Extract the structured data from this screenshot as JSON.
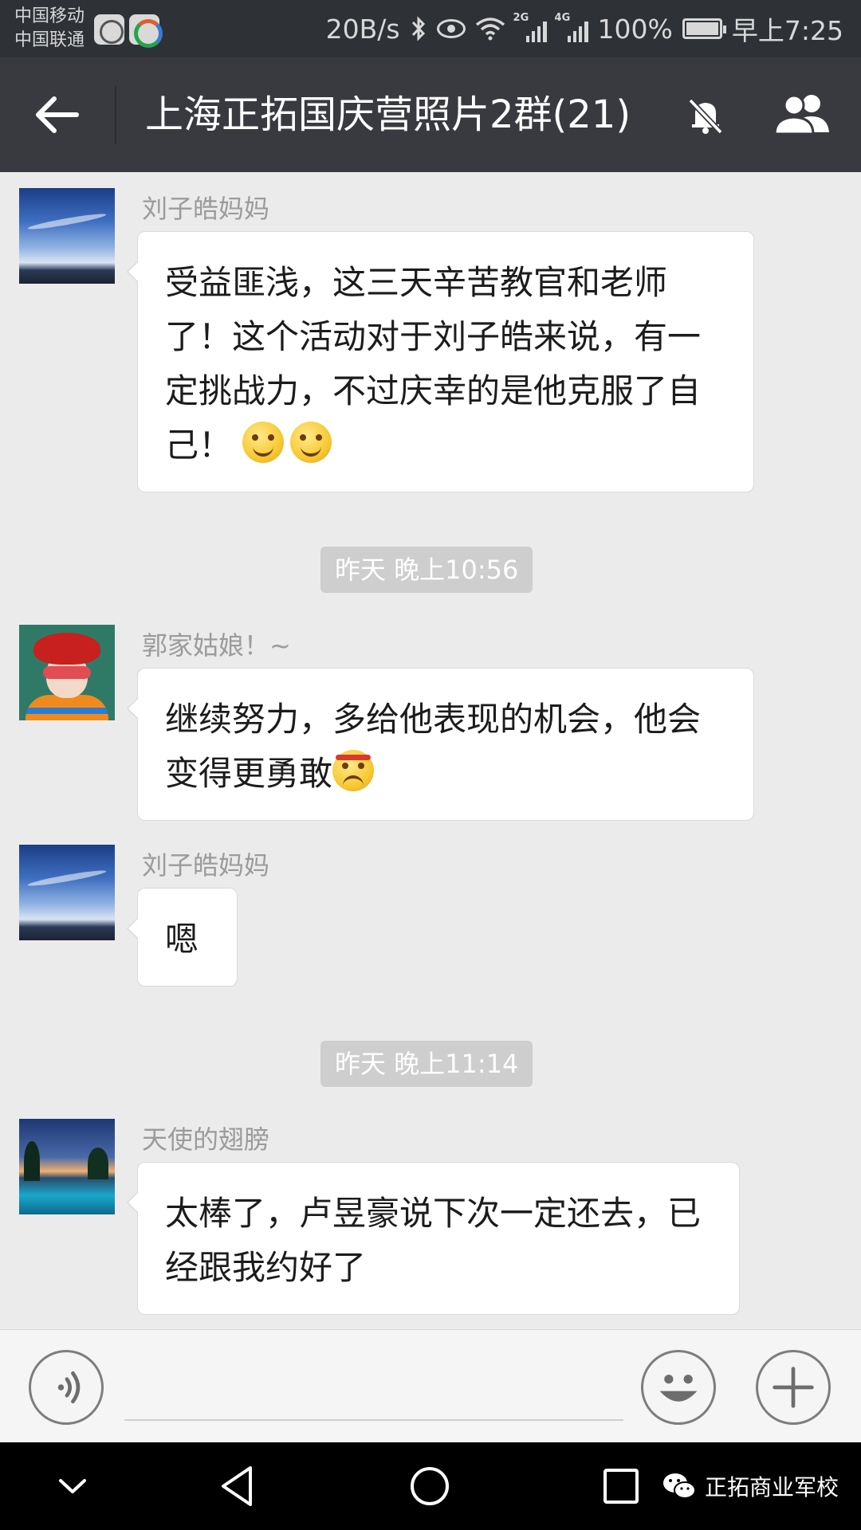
{
  "status_bar": {
    "carrier1": "中国移动",
    "carrier2": "中国联通",
    "speed": "20B/s",
    "net1": "2G",
    "net2": "4G",
    "battery": "100%",
    "time": "早上7:25"
  },
  "header": {
    "title": "上海正拓国庆营照片2群(21)",
    "back_icon": "arrow-left-icon",
    "mute_icon": "bell-off-icon",
    "members_icon": "people-icon"
  },
  "messages": [
    {
      "sender": "刘子皓妈妈",
      "text": "受益匪浅，这三天辛苦教官和老师了！这个活动对于刘子皓来说，有一定挑战力，不过庆幸的是他克服了自己！",
      "emoji": "smile-emoji-x2"
    },
    {
      "sender": "郭家姑娘！~",
      "text": "继续努力，多给他表现的机会，他会变得更勇敢",
      "emoji": "determined-emoji"
    },
    {
      "sender": "刘子皓妈妈",
      "text": "嗯"
    },
    {
      "sender": "天使的翅膀",
      "text": "太棒了，卢昱豪说下次一定还去，已经跟我约好了"
    }
  ],
  "timestamps": [
    "昨天 晚上10:56",
    "昨天 晚上11:14"
  ],
  "input_bar": {
    "voice_icon": "voice-icon",
    "emoji_icon": "emoji-icon",
    "plus_icon": "plus-icon",
    "placeholder": ""
  },
  "nav_bar": {
    "watermark": "正拓商业军校"
  },
  "colors": {
    "header_bg": "#393a3f",
    "status_bg": "#2e3236",
    "chat_bg": "#ebebeb",
    "bubble_bg": "#ffffff",
    "time_pill_bg": "#cecece"
  }
}
